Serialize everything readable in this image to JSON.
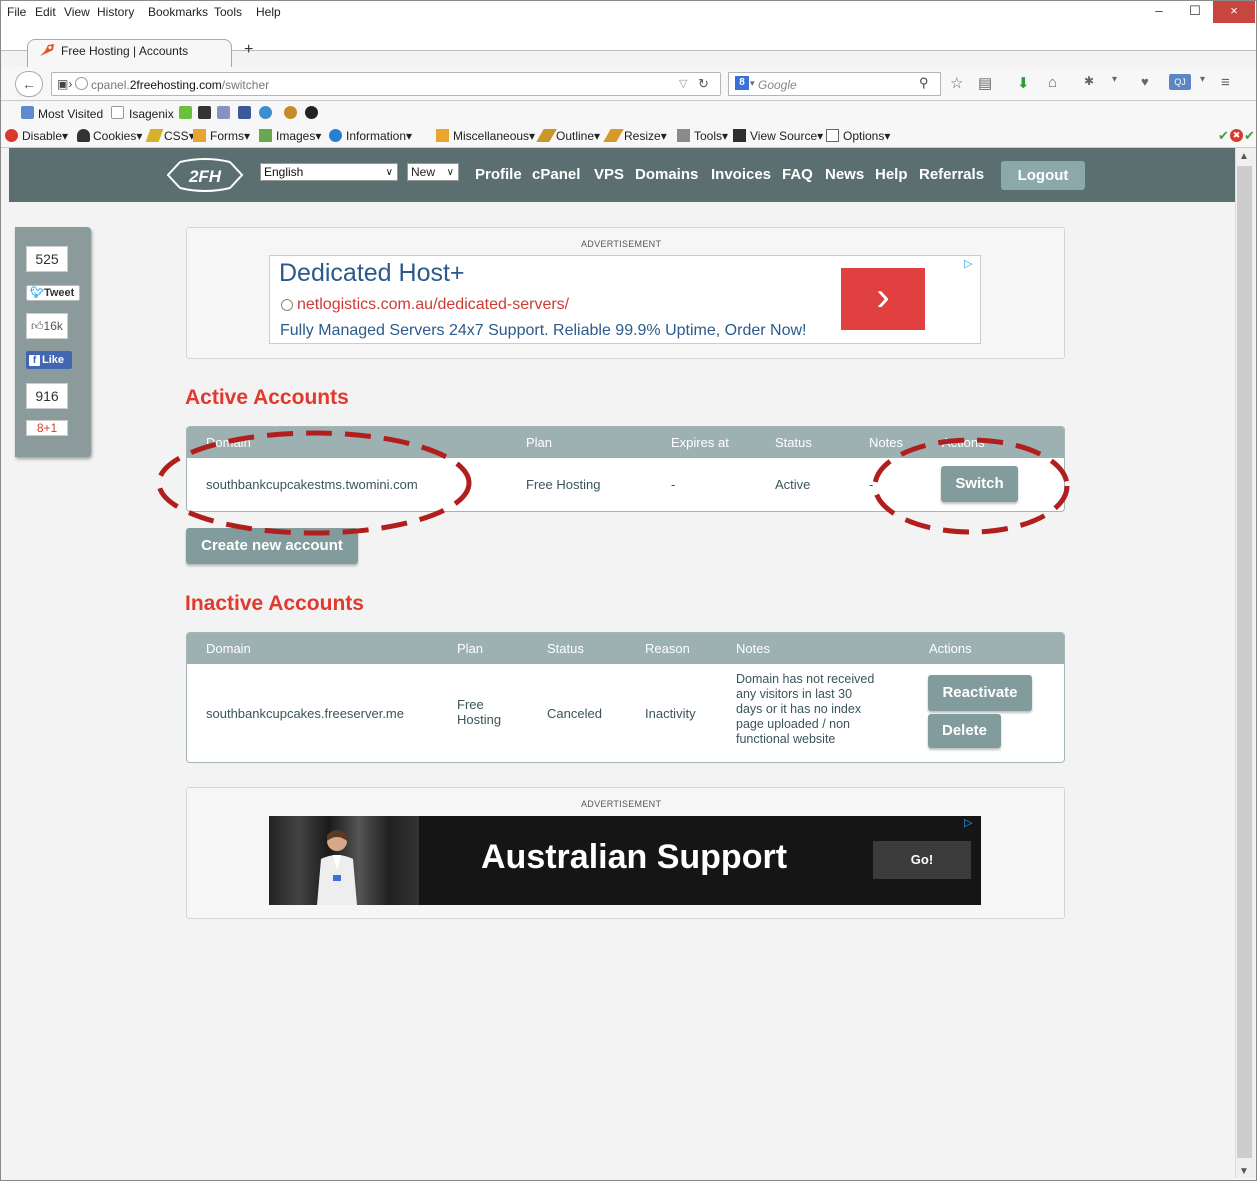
{
  "menubar": {
    "items": [
      "File",
      "Edit",
      "View",
      "History",
      "Bookmarks",
      "Tools",
      "Help"
    ]
  },
  "window_controls": {
    "minimize": "–",
    "maximize": "☐",
    "close": "×"
  },
  "tab": {
    "title": "Free Hosting | Accounts",
    "new_tab": "+"
  },
  "nav": {
    "url_prefix": "cpanel.",
    "url_host": "2freehosting.com",
    "url_path": "/switcher",
    "search_placeholder": "Google",
    "search_engine_letter": "8"
  },
  "bookmarks": {
    "items": [
      "Most Visited",
      "Isagenix"
    ]
  },
  "devbar": {
    "items": [
      "Disable",
      "Cookies",
      "CSS",
      "Forms",
      "Images",
      "Information",
      "Miscellaneous",
      "Outline",
      "Resize",
      "Tools",
      "View Source",
      "Options"
    ]
  },
  "site": {
    "language": "English",
    "new_select": "New",
    "nav_links": [
      "Profile",
      "cPanel",
      "VPS",
      "Domains",
      "Invoices",
      "FAQ",
      "News",
      "Help",
      "Referrals"
    ],
    "logout": "Logout",
    "logo_text": "2FH"
  },
  "social": {
    "tweet_count": "525",
    "tweet_label": "Tweet",
    "fb_count": "16k",
    "fb_label": "Like",
    "gplus_count": "916",
    "gplus_label": "8+1"
  },
  "ad1": {
    "label": "ADVERTISEMENT",
    "title": "Dedicated Host+",
    "url": "netlogistics.com.au/dedicated-servers/",
    "desc": "Fully Managed Servers 24x7 Support. Reliable 99.9% Uptime, Order Now!",
    "go": "›"
  },
  "ad2": {
    "label": "ADVERTISEMENT",
    "title": "Australian Support",
    "go": "Go!"
  },
  "active": {
    "heading": "Active Accounts",
    "headers": [
      "Domain",
      "Plan",
      "Expires at",
      "Status",
      "Notes",
      "Actions"
    ],
    "row": {
      "domain": "southbankcupcakestms.twomini.com",
      "plan": "Free Hosting",
      "expires": "-",
      "status": "Active",
      "notes": "-",
      "action": "Switch"
    },
    "create_button": "Create new account"
  },
  "inactive": {
    "heading": "Inactive Accounts",
    "headers": [
      "Domain",
      "Plan",
      "Status",
      "Reason",
      "Notes",
      "Actions"
    ],
    "row": {
      "domain": "southbankcupcakes.freeserver.me",
      "plan_line1": "Free",
      "plan_line2": "Hosting",
      "status": "Canceled",
      "reason": "Inactivity",
      "notes_lines": [
        "Domain has not received",
        "any visitors in last 30",
        "days or it has no index",
        "page uploaded / non",
        "functional website"
      ],
      "action1": "Reactivate",
      "action2": "Delete"
    }
  },
  "colors": {
    "accent_red": "#e03a2f",
    "nav_bg": "#5c6f70",
    "table_header": "#9eb1b2",
    "button": "#829b9d",
    "annotation": "#b01e1e"
  }
}
